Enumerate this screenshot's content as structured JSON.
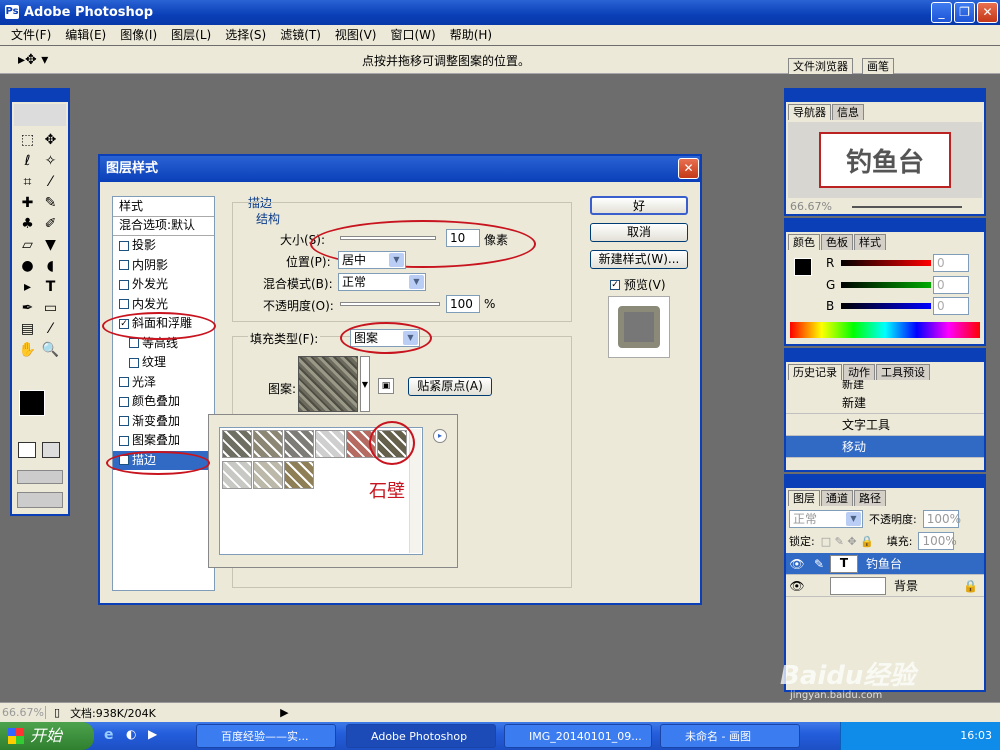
{
  "app": {
    "title": "Adobe Photoshop",
    "title_icon": "photoshop-icon"
  },
  "menu": [
    "文件(F)",
    "编辑(E)",
    "图像(I)",
    "图层(L)",
    "选择(S)",
    "滤镜(T)",
    "视图(V)",
    "窗口(W)",
    "帮助(H)"
  ],
  "options": {
    "hint": "点按并拖移可调整图案的位置。",
    "tab_browser": "文件浏览器",
    "tab_brush": "画笔"
  },
  "navigator": {
    "tabs": [
      "导航器",
      "信息"
    ],
    "preview_text": "钓鱼台",
    "zoom": "66.67%"
  },
  "color_panel": {
    "tabs": [
      "颜色",
      "色板",
      "样式"
    ],
    "labels": [
      "R",
      "G",
      "B"
    ],
    "values": [
      "0",
      "0",
      "0"
    ]
  },
  "history": {
    "tabs": [
      "历史记录",
      "动作",
      "工具预设"
    ],
    "items": [
      "新建",
      "新建",
      "文字工具",
      "移动"
    ]
  },
  "layers": {
    "tabs": [
      "图层",
      "通道",
      "路径"
    ],
    "blend": "正常",
    "opacity_label": "不透明度:",
    "opacity": "100%",
    "lock_label": "锁定:",
    "fill_label": "填充:",
    "fill": "100%",
    "rows": [
      {
        "name": "钓鱼台",
        "type": "T"
      },
      {
        "name": "背景"
      }
    ]
  },
  "dialog": {
    "title": "图层样式",
    "list_header": "样式",
    "blend_default": "混合选项:默认",
    "styles": [
      {
        "label": "投影",
        "checked": false
      },
      {
        "label": "内阴影",
        "checked": false
      },
      {
        "label": "外发光",
        "checked": false
      },
      {
        "label": "内发光",
        "checked": false
      },
      {
        "label": "斜面和浮雕",
        "checked": true
      },
      {
        "label": "等高线",
        "checked": false
      },
      {
        "label": "纹理",
        "checked": false
      },
      {
        "label": "光泽",
        "checked": false
      },
      {
        "label": "颜色叠加",
        "checked": false
      },
      {
        "label": "渐变叠加",
        "checked": false
      },
      {
        "label": "图案叠加",
        "checked": false
      },
      {
        "label": "描边",
        "checked": true
      }
    ],
    "section": "描边",
    "group": "结构",
    "size_label": "大小(S):",
    "size_value": "10",
    "size_unit": "像素",
    "position_label": "位置(P):",
    "position_value": "居中",
    "blend_label": "混合模式(B):",
    "blend_value": "正常",
    "opacity_label": "不透明度(O):",
    "opacity_value": "100",
    "opacity_unit": "%",
    "fill_type_label": "填充类型(F):",
    "fill_type_value": "图案",
    "pattern_label": "图案:",
    "snap_button": "贴紧原点(A)",
    "ok": "好",
    "cancel": "取消",
    "new_style": "新建样式(W)...",
    "preview_label": "预览(V)",
    "annotation": "石壁"
  },
  "status": {
    "zoom": "66.67%",
    "doc": "文档:938K/204K"
  },
  "taskbar": {
    "start": "开始",
    "tasks": [
      "百度经验——实...",
      "Adobe Photoshop",
      "IMG_20140101_09...",
      "未命名 - 画图"
    ],
    "time": "16:03"
  },
  "watermark": {
    "text": "Baidu经验",
    "url": "jingyan.baidu.com"
  }
}
